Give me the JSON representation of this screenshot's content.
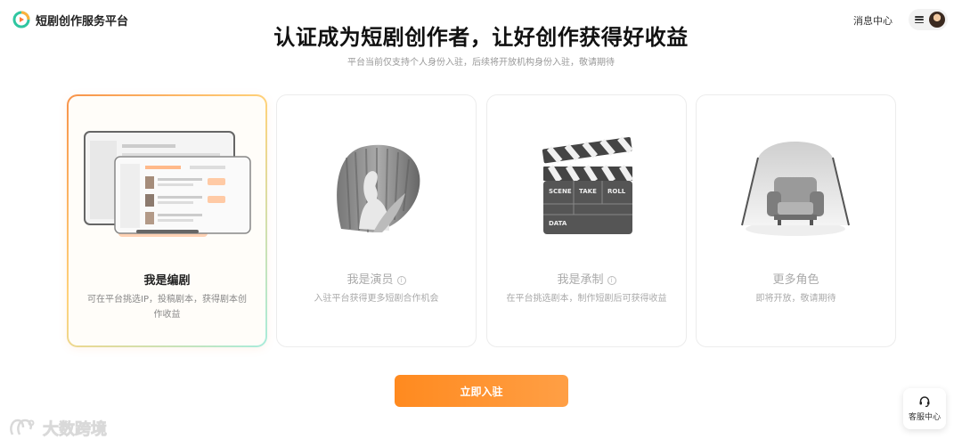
{
  "header": {
    "app_name": "短剧创作服务平台",
    "message_center": "消息中心"
  },
  "hero": {
    "title": "认证成为短剧创作者，让好创作获得好收益",
    "subtitle": "平台当前仅支持个人身份入驻，后续将开放机构身份入驻，敬请期待"
  },
  "roles": [
    {
      "title": "我是编剧",
      "desc": "可在平台挑选IP，投稿剧本，获得剧本创作收益",
      "selected": true,
      "info": false
    },
    {
      "title": "我是演员",
      "desc": "入驻平台获得更多短剧合作机会",
      "selected": false,
      "info": true
    },
    {
      "title": "我是承制",
      "desc": "在平台挑选剧本，制作短剧后可获得收益",
      "selected": false,
      "info": true
    },
    {
      "title": "更多角色",
      "desc": "即将开放，敬请期待",
      "selected": false,
      "info": false
    }
  ],
  "clapboard": {
    "scene": "SCENE",
    "take": "TAKE",
    "roll": "ROLL",
    "data": "DATA"
  },
  "cta": {
    "label": "立即入驻"
  },
  "service": {
    "label": "客服中心"
  },
  "watermark": {
    "text": "大数跨境"
  },
  "colors": {
    "accent": "#ff8a1f",
    "selected_border_start": "#f8934a",
    "selected_border_end": "#a8ecdc"
  }
}
